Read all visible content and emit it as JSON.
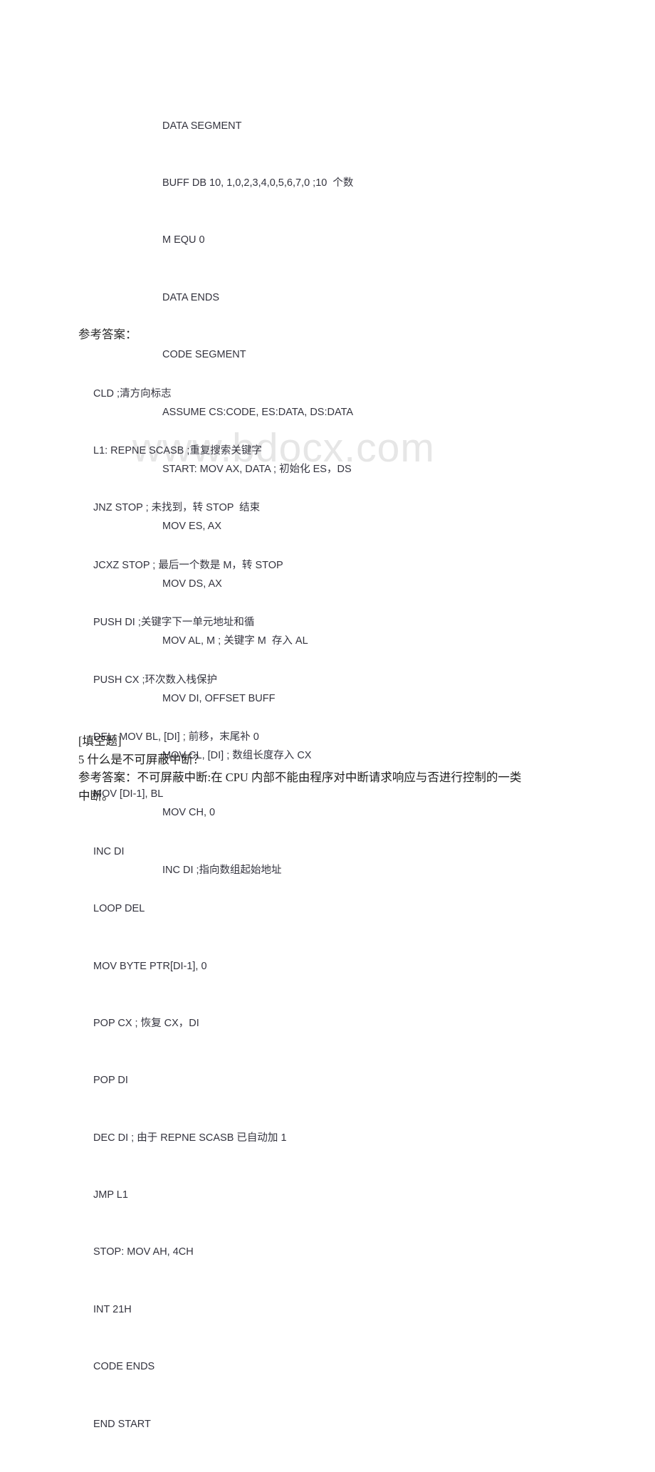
{
  "document": {
    "watermark": "www.bdocx.com",
    "answer_label": "参考答案：",
    "code_block_top": [
      "DATA SEGMENT",
      "BUFF DB 10, 1,0,2,3,4,0,5,6,7,0 ;10  个数",
      "M EQU 0",
      "DATA ENDS",
      "CODE SEGMENT",
      "ASSUME CS:CODE, ES:DATA, DS:DATA",
      "START: MOV AX, DATA ; 初始化 ES，DS",
      "MOV ES, AX",
      "MOV DS, AX",
      "MOV AL, M ; 关键字 M  存入 AL",
      "MOV DI, OFFSET BUFF",
      "MOV CL, [DI] ; 数组长度存入 CX",
      "MOV CH, 0",
      "INC DI ;指向数组起始地址"
    ],
    "code_block_bottom": [
      "CLD ;清方向标志",
      "L1: REPNE SCASB ;重复搜索关键字",
      "JNZ STOP ; 未找到，转 STOP  结束",
      "JCXZ STOP ; 最后一个数是 M，转 STOP",
      "PUSH DI ;关键字下一单元地址和循",
      "PUSH CX ;环次数入栈保护",
      "DEL: MOV BL, [DI] ; 前移，末尾补 0",
      "MOV [DI-1], BL",
      "INC DI",
      "LOOP DEL",
      "MOV BYTE PTR[DI-1], 0",
      "POP CX ; 恢复 CX，DI",
      "POP DI",
      "DEC DI ; 由于 REPNE SCASB 已自动加 1",
      "JMP L1",
      "STOP: MOV AH, 4CH",
      "INT 21H",
      "CODE ENDS",
      "END START"
    ],
    "bottom": {
      "question_type": "[填空题]",
      "question": "5 什么是不可屏蔽中断？",
      "answer_line_1": "参考答案：不可屏蔽中断:在 CPU 内部不能由程序对中断请求响应与否进行控制的一类",
      "answer_line_2": "中断。"
    }
  }
}
